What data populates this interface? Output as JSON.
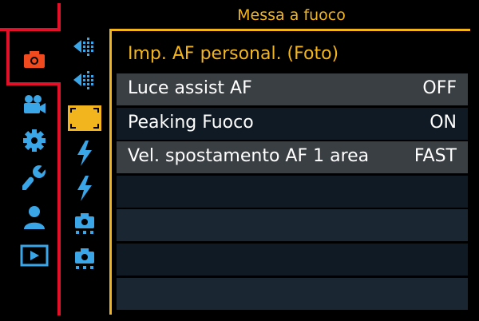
{
  "header": {
    "title": "Messa a fuoco"
  },
  "colors": {
    "accent": "#f2b51e",
    "selection_frame": "#e3102a",
    "icon_blue": "#3aa6e8",
    "camera_red": "#f04a1e"
  },
  "categories": [
    {
      "icon": "camera-icon",
      "selected": true
    },
    {
      "icon": "video-camera-icon"
    },
    {
      "icon": "gear-icon"
    },
    {
      "icon": "wrench-icon"
    },
    {
      "icon": "person-icon"
    },
    {
      "icon": "playback-icon"
    }
  ],
  "subtabs": [
    {
      "icon": "af-grid-icon-1"
    },
    {
      "icon": "af-grid-icon-2"
    },
    {
      "icon": "focus-tab-icon",
      "label": "FOCUS",
      "selected": true
    },
    {
      "icon": "flash-icon-1"
    },
    {
      "icon": "flash-icon-2"
    },
    {
      "icon": "camera-custom-icon-1"
    },
    {
      "icon": "camera-custom-icon-2"
    }
  ],
  "menu": {
    "items": [
      {
        "label": "Imp. AF personal. (Foto)",
        "value": ""
      },
      {
        "label": "Luce assist AF",
        "value": "OFF"
      },
      {
        "label": "Peaking Fuoco",
        "value": "ON"
      },
      {
        "label": "Vel. spostamento AF 1 area",
        "value": "FAST"
      }
    ]
  }
}
